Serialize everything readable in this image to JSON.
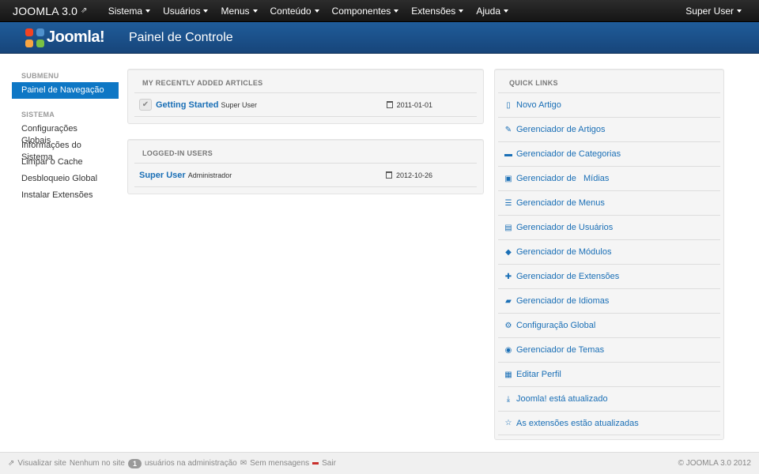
{
  "topbar": {
    "brand": "JOOMLA 3.0",
    "menu": [
      "Sistema",
      "Usuários",
      "Menus",
      "Conteúdo",
      "Componentes",
      "Extensões",
      "Ajuda"
    ],
    "user": "Super User"
  },
  "header": {
    "logo_text": "Joomla!",
    "title": "Painel de Controle"
  },
  "sidebar": {
    "submenu_header": "SUBMENU",
    "active_item": "Painel de Navegação",
    "system_header": "SISTEMA",
    "items": [
      "Configurações Globais",
      "Informações do Sistema",
      "Limpar o Cache",
      "Desbloqueio Global",
      "Instalar Extensões"
    ]
  },
  "articles": {
    "title": "MY RECENTLY ADDED ARTICLES",
    "rows": [
      {
        "title": "Getting Started",
        "author": "Super User",
        "date": "2011-01-01"
      }
    ]
  },
  "users": {
    "title": "LOGGED-IN USERS",
    "rows": [
      {
        "name": "Super User",
        "role": "Administrador",
        "date": "2012-10-26"
      }
    ]
  },
  "quicklinks": {
    "title": "QUICK LINKS",
    "items": [
      {
        "label": "Novo Artigo",
        "icon": "file-icon"
      },
      {
        "label": "Gerenciador de Artigos",
        "icon": "pencil-icon"
      },
      {
        "label": "Gerenciador de Categorias",
        "icon": "folder-icon"
      },
      {
        "label": "Gerenciador de   Mídias",
        "icon": "picture-icon"
      },
      {
        "label": "Gerenciador de Menus",
        "icon": "list-icon"
      },
      {
        "label": "Gerenciador de Usuários",
        "icon": "user-icon"
      },
      {
        "label": "Gerenciador de Módulos",
        "icon": "cube-icon"
      },
      {
        "label": "Gerenciador de Extensões",
        "icon": "puzzle-icon"
      },
      {
        "label": "Gerenciador de Idiomas",
        "icon": "comment-icon"
      },
      {
        "label": "Configuração Global",
        "icon": "gear-icon"
      },
      {
        "label": "Gerenciador de Temas",
        "icon": "eye-icon"
      },
      {
        "label": "Editar Perfil",
        "icon": "profile-icon"
      },
      {
        "label": "Joomla! está atualizado",
        "icon": "download-icon"
      },
      {
        "label": "As extensões estão atualizadas",
        "icon": "star-icon"
      }
    ]
  },
  "footer": {
    "view_site": "Visualizar site",
    "no_site": "Nenhum no site",
    "admin_count": "1",
    "admin_text": "usuários na administração",
    "messages": "Sem mensagens",
    "logout": "Sair",
    "copyright": "© JOOMLA 3.0 2012"
  }
}
